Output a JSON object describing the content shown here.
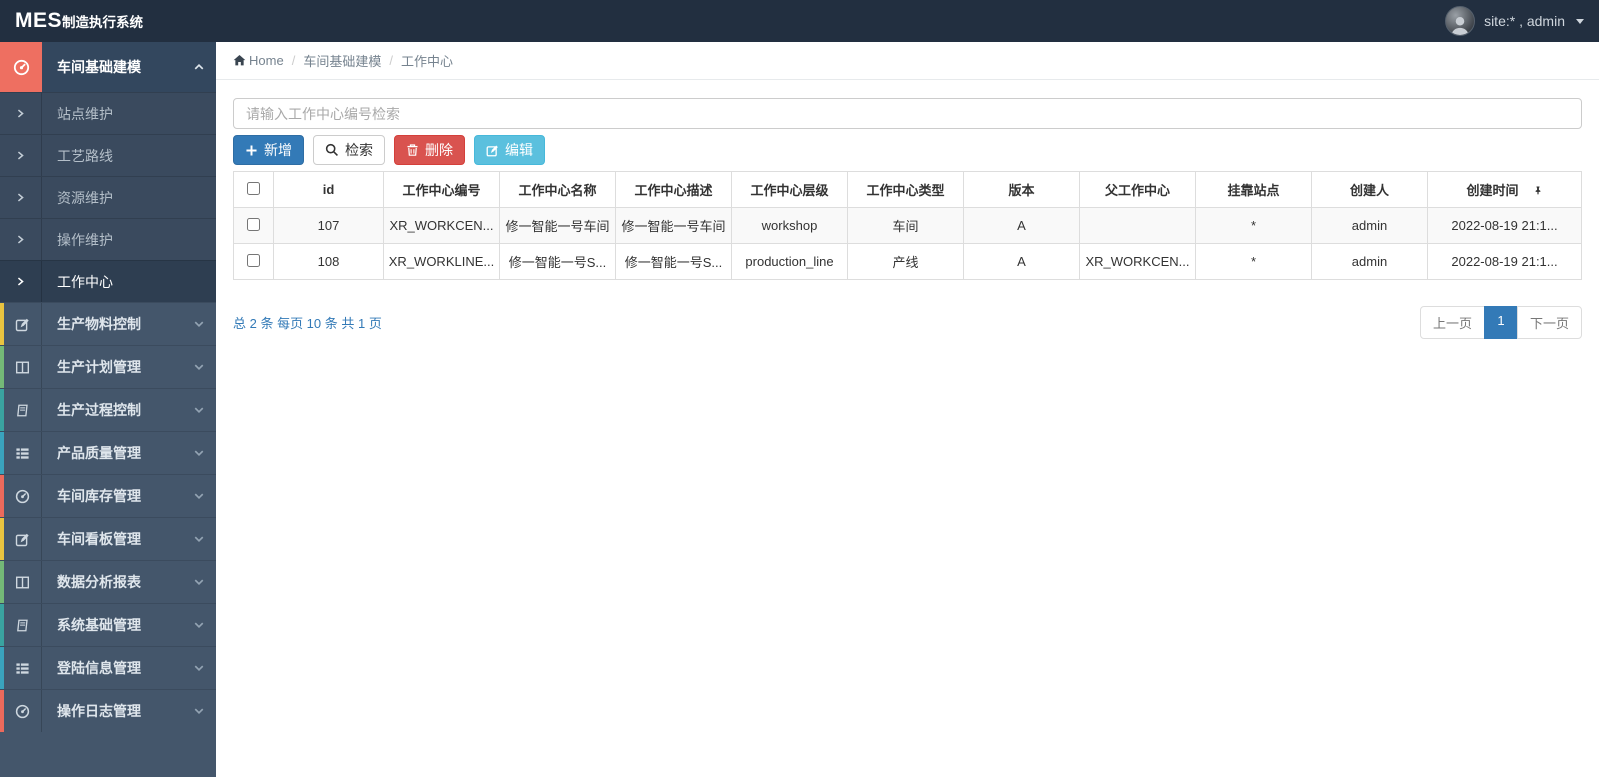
{
  "navbar": {
    "brand_mes": "MES",
    "brand_rest": "制造执行系统",
    "user_label": "site:* , admin"
  },
  "sidebar": {
    "parent": {
      "label": "车间基础建模",
      "accent": "#ee6f61"
    },
    "submenu_items": [
      {
        "label": "站点维护"
      },
      {
        "label": "工艺路线"
      },
      {
        "label": "资源维护"
      },
      {
        "label": "操作维护"
      },
      {
        "label": "工作中心"
      }
    ],
    "items": [
      {
        "label": "生产物料控制",
        "icon": "edit-icon",
        "strip": "#e9c440"
      },
      {
        "label": "生产计划管理",
        "icon": "columns-icon",
        "strip": "#74b977"
      },
      {
        "label": "生产过程控制",
        "icon": "book-icon",
        "strip": "#3aa3a0"
      },
      {
        "label": "产品质量管理",
        "icon": "list-icon",
        "strip": "#3aa3bd"
      },
      {
        "label": "车间库存管理",
        "icon": "gauge-icon",
        "strip": "#ec6a5c"
      },
      {
        "label": "车间看板管理",
        "icon": "edit-icon",
        "strip": "#e9c440"
      },
      {
        "label": "数据分析报表",
        "icon": "columns-icon",
        "strip": "#74b977"
      },
      {
        "label": "系统基础管理",
        "icon": "book-icon",
        "strip": "#3aa3a0"
      },
      {
        "label": "登陆信息管理",
        "icon": "list-icon",
        "strip": "#3aa3bd"
      },
      {
        "label": "操作日志管理",
        "icon": "gauge-icon",
        "strip": "#ec6a5c"
      }
    ]
  },
  "breadcrumb": {
    "home": "Home",
    "level1": "车间基础建模",
    "level2": "工作中心"
  },
  "toolbar": {
    "search_placeholder": "请输入工作中心编号检索",
    "add_label": "新增",
    "search_label": "检索",
    "delete_label": "删除",
    "edit_label": "编辑"
  },
  "table": {
    "columns": [
      "id",
      "工作中心编号",
      "工作中心名称",
      "工作中心描述",
      "工作中心层级",
      "工作中心类型",
      "版本",
      "父工作中心",
      "挂靠站点",
      "创建人",
      "创建时间"
    ],
    "rows": [
      {
        "cells": [
          "107",
          "XR_WORKCEN...",
          "修一智能一号车间",
          "修一智能一号车间",
          "workshop",
          "车间",
          "A",
          "",
          "*",
          "admin",
          "2022-08-19 21:1..."
        ]
      },
      {
        "cells": [
          "108",
          "XR_WORKLINE...",
          "修一智能一号S...",
          "修一智能一号S...",
          "production_line",
          "产线",
          "A",
          "XR_WORKCEN...",
          "*",
          "admin",
          "2022-08-19 21:1..."
        ]
      }
    ]
  },
  "pagination": {
    "summary": "总 2 条  每页 10 条  共 1 页",
    "prev_label": "上一页",
    "page_label": "1",
    "next_label": "下一页"
  },
  "colors": {
    "primary": "#337ab7",
    "danger": "#d9534f",
    "info": "#5bc0de",
    "active_accent": "#ee6f61",
    "navbar_bg": "#222f40",
    "sidebar_bg": "#44566b"
  }
}
